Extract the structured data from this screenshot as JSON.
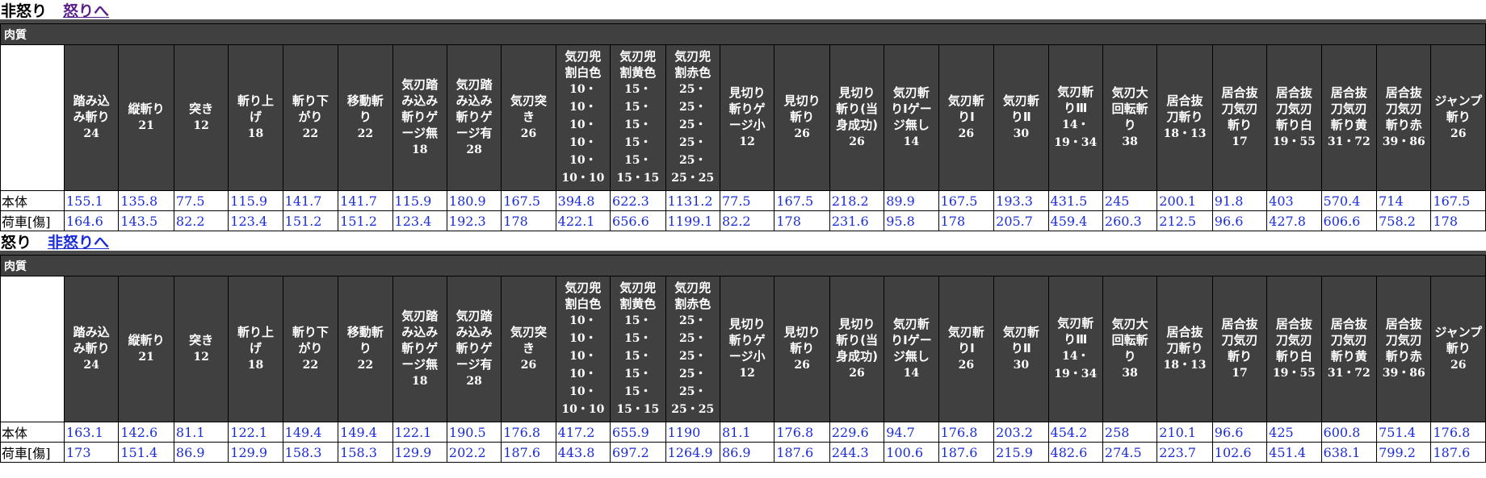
{
  "sections": [
    {
      "title": "非怒り",
      "link": "怒りへ",
      "link_state": "visited",
      "caption": "肉質",
      "rows": [
        {
          "label": "本体",
          "values": [
            "155.1",
            "135.8",
            "77.5",
            "115.9",
            "141.7",
            "141.7",
            "115.9",
            "180.9",
            "167.5",
            "394.8",
            "622.3",
            "1131.2",
            "77.5",
            "167.5",
            "218.2",
            "89.9",
            "167.5",
            "193.3",
            "431.5",
            "245",
            "200.1",
            "91.8",
            "403",
            "570.4",
            "714",
            "167.5"
          ]
        },
        {
          "label": "荷車[傷]",
          "values": [
            "164.6",
            "143.5",
            "82.2",
            "123.4",
            "151.2",
            "151.2",
            "123.4",
            "192.3",
            "178",
            "422.1",
            "656.6",
            "1199.1",
            "82.2",
            "178",
            "231.6",
            "95.8",
            "178",
            "205.7",
            "459.4",
            "260.3",
            "212.5",
            "96.6",
            "427.8",
            "606.6",
            "758.2",
            "178"
          ]
        }
      ]
    },
    {
      "title": "怒り",
      "link": "非怒りへ",
      "link_state": "normal",
      "caption": "肉質",
      "rows": [
        {
          "label": "本体",
          "values": [
            "163.1",
            "142.6",
            "81.1",
            "122.1",
            "149.4",
            "149.4",
            "122.1",
            "190.5",
            "176.8",
            "417.2",
            "655.9",
            "1190",
            "81.1",
            "176.8",
            "229.6",
            "94.7",
            "176.8",
            "203.2",
            "454.2",
            "258",
            "210.1",
            "96.6",
            "425",
            "600.8",
            "751.4",
            "176.8"
          ]
        },
        {
          "label": "荷車[傷]",
          "values": [
            "173",
            "151.4",
            "86.9",
            "129.9",
            "158.3",
            "158.3",
            "129.9",
            "202.2",
            "187.6",
            "443.8",
            "697.2",
            "1264.9",
            "86.9",
            "187.6",
            "244.3",
            "100.6",
            "187.6",
            "215.9",
            "482.6",
            "274.5",
            "223.7",
            "102.6",
            "451.4",
            "638.1",
            "799.2",
            "187.6"
          ]
        }
      ]
    }
  ],
  "columns": [
    {
      "name": [
        "踏み込",
        "み斬り"
      ],
      "motion": [
        "24"
      ]
    },
    {
      "name": [
        "縦斬り"
      ],
      "motion": [
        "21"
      ]
    },
    {
      "name": [
        "突き"
      ],
      "motion": [
        "12"
      ]
    },
    {
      "name": [
        "斬り上",
        "げ"
      ],
      "motion": [
        "18"
      ]
    },
    {
      "name": [
        "斬り下",
        "がり"
      ],
      "motion": [
        "22"
      ]
    },
    {
      "name": [
        "移動斬",
        "り"
      ],
      "motion": [
        "22"
      ]
    },
    {
      "name": [
        "気刃踏",
        "み込み",
        "斬りゲ",
        "ージ無"
      ],
      "motion": [
        "18"
      ]
    },
    {
      "name": [
        "気刃踏",
        "み込み",
        "斬りゲ",
        "ージ有"
      ],
      "motion": [
        "28"
      ]
    },
    {
      "name": [
        "気刃突",
        "き"
      ],
      "motion": [
        "26"
      ]
    },
    {
      "name": [
        "気刃兜",
        "割白色"
      ],
      "motion": [
        "10・",
        "10・",
        "10・",
        "10・",
        "10・",
        "10・10"
      ]
    },
    {
      "name": [
        "気刃兜",
        "割黄色"
      ],
      "motion": [
        "15・",
        "15・",
        "15・",
        "15・",
        "15・",
        "15・15"
      ]
    },
    {
      "name": [
        "気刃兜",
        "割赤色"
      ],
      "motion": [
        "25・",
        "25・",
        "25・",
        "25・",
        "25・",
        "25・25"
      ]
    },
    {
      "name": [
        "見切り",
        "斬りゲ",
        "ージ小"
      ],
      "motion": [
        "12"
      ]
    },
    {
      "name": [
        "見切り",
        "斬り"
      ],
      "motion": [
        "26"
      ]
    },
    {
      "name": [
        "見切り",
        "斬り(当",
        "身成功)"
      ],
      "motion": [
        "26"
      ]
    },
    {
      "name": [
        "気刃斬",
        "りIゲー",
        "ジ無し"
      ],
      "motion": [
        "14"
      ]
    },
    {
      "name": [
        "気刃斬",
        "りI"
      ],
      "motion": [
        "26"
      ]
    },
    {
      "name": [
        "気刃斬",
        "りⅡ"
      ],
      "motion": [
        "30"
      ]
    },
    {
      "name": [
        "気刃斬",
        "りⅢ"
      ],
      "motion": [
        "14・",
        "19・34"
      ]
    },
    {
      "name": [
        "気刃大",
        "回転斬",
        "り"
      ],
      "motion": [
        "38"
      ]
    },
    {
      "name": [
        "居合抜",
        "刀斬り"
      ],
      "motion": [
        "18・13"
      ]
    },
    {
      "name": [
        "居合抜",
        "刀気刃",
        "斬り"
      ],
      "motion": [
        "17"
      ]
    },
    {
      "name": [
        "居合抜",
        "刀気刃",
        "斬り白"
      ],
      "motion": [
        "19・55"
      ]
    },
    {
      "name": [
        "居合抜",
        "刀気刃",
        "斬り黄"
      ],
      "motion": [
        "31・72"
      ]
    },
    {
      "name": [
        "居合抜",
        "刀気刃",
        "斬り赤"
      ],
      "motion": [
        "39・86"
      ]
    },
    {
      "name": [
        "ジャンプ",
        "斬り"
      ],
      "motion": [
        "26"
      ]
    }
  ],
  "colors": {
    "header_bg": "#404040",
    "header_text": "#ffffff",
    "value_text": "#1a2dd8",
    "link_visited": "#5a1f8a"
  }
}
